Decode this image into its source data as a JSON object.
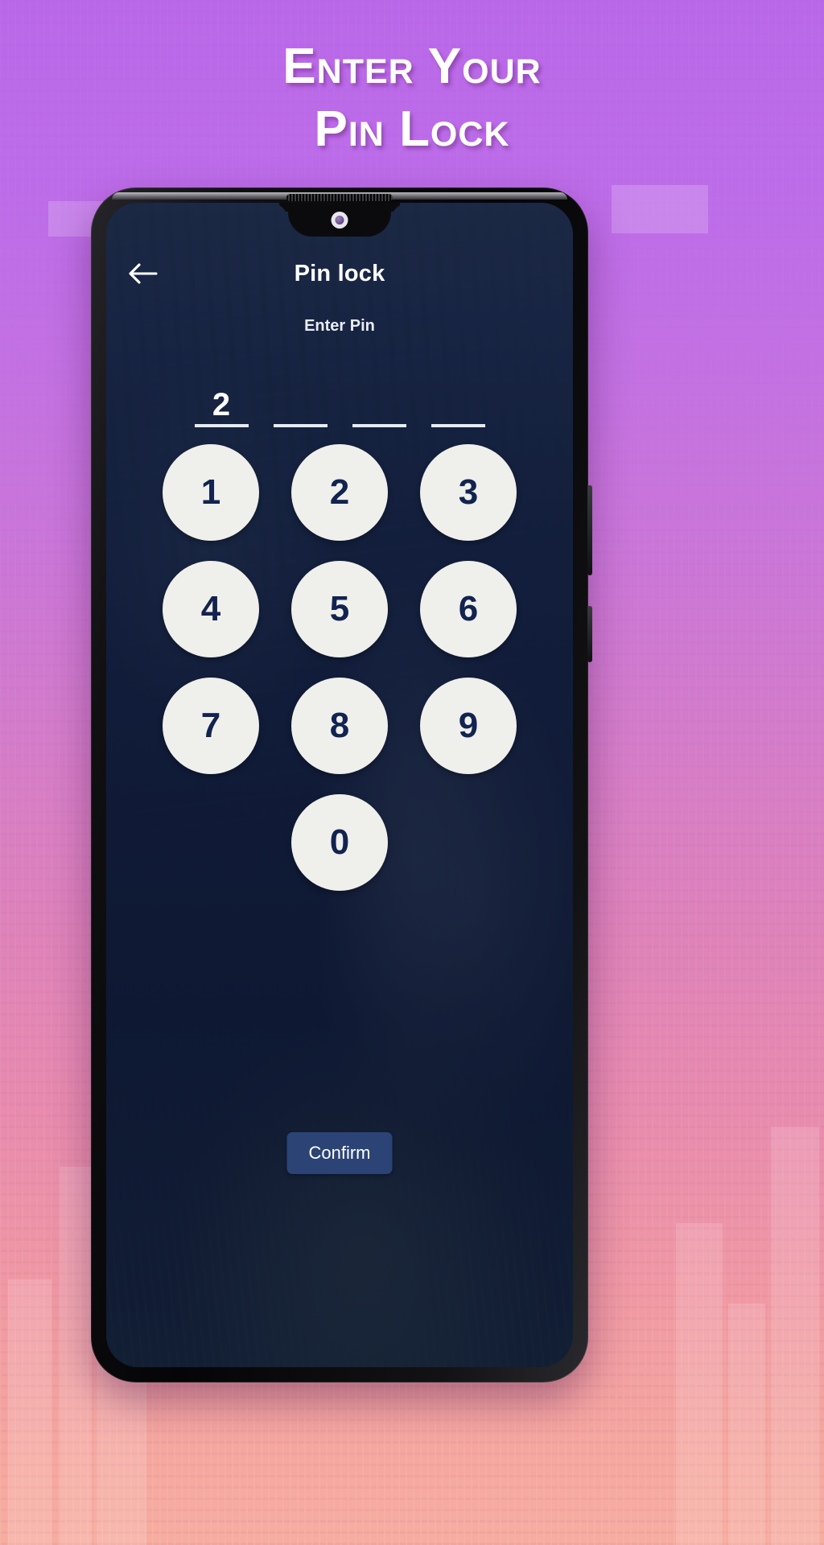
{
  "promo": {
    "headline_line1": "Enter Your",
    "headline_line2": "Pin Lock",
    "gradient_top": "#b968e8",
    "gradient_bottom": "#f7ada0"
  },
  "phone": {
    "frame_color": "#050507",
    "icons": {
      "earpiece": "earpiece-speaker-icon",
      "camera": "front-camera-icon",
      "volume": "volume-button",
      "power": "power-button"
    }
  },
  "app": {
    "appbar": {
      "back_icon": "back-arrow-icon",
      "title": "Pin lock"
    },
    "subtitle": "Enter Pin",
    "pin": {
      "length": 4,
      "slots": [
        "2",
        "",
        "",
        ""
      ]
    },
    "keypad": {
      "rows": [
        [
          "1",
          "2",
          "3"
        ],
        [
          "4",
          "5",
          "6"
        ],
        [
          "7",
          "8",
          "9"
        ],
        [
          "0"
        ]
      ]
    },
    "confirm_label": "Confirm",
    "colors": {
      "screen_bg": "#16244a",
      "key_bg": "#efefec",
      "key_text": "#122350",
      "confirm_bg": "#2b4375",
      "accent_text": "#ffffff"
    }
  }
}
